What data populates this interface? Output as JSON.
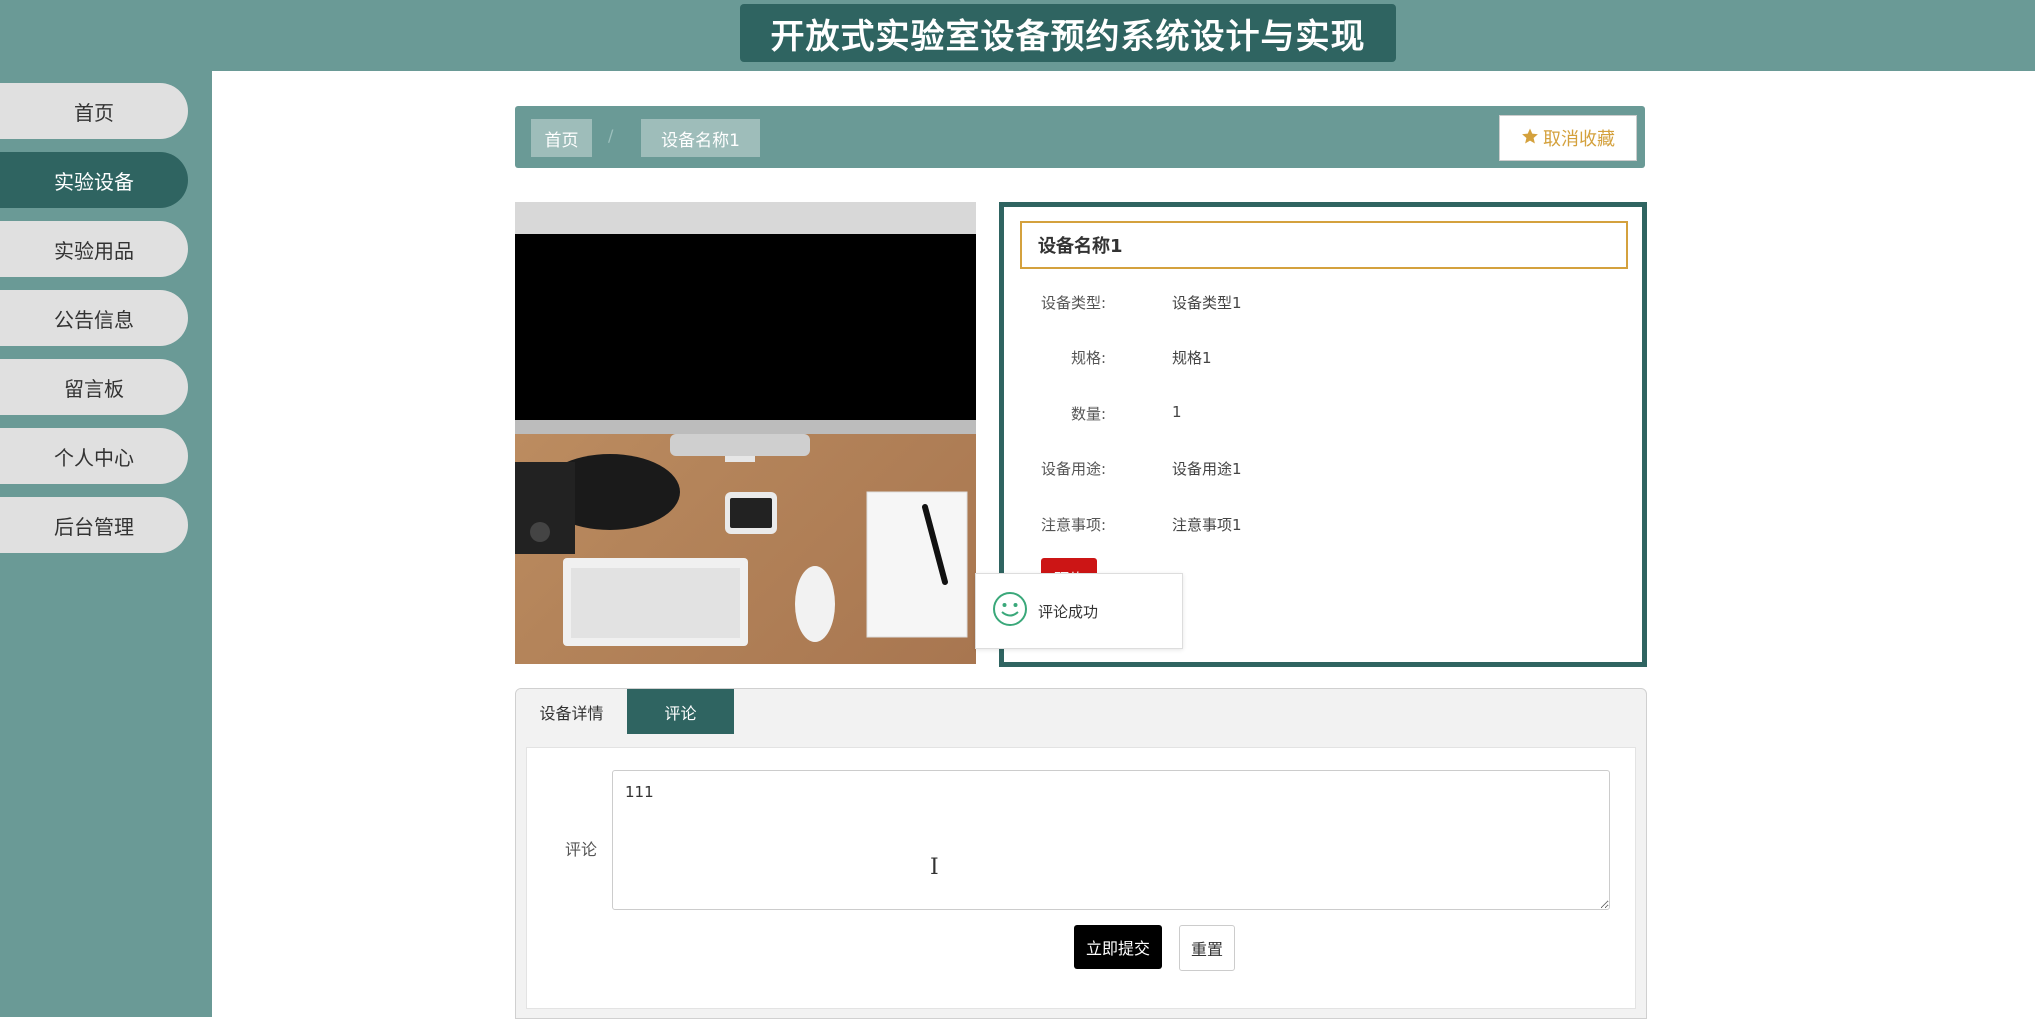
{
  "header": {
    "title": "开放式实验室设备预约系统设计与实现"
  },
  "sidebar": {
    "items": [
      {
        "label": "首页"
      },
      {
        "label": "实验设备"
      },
      {
        "label": "实验用品"
      },
      {
        "label": "公告信息"
      },
      {
        "label": "留言板"
      },
      {
        "label": "个人中心"
      },
      {
        "label": "后台管理"
      }
    ],
    "active_index": 1
  },
  "breadcrumb": {
    "home": "首页",
    "separator": "/",
    "current": "设备名称1",
    "favorite_label": "取消收藏",
    "favorite_icon": "star-icon"
  },
  "detail": {
    "name": "设备名称1",
    "fields": [
      {
        "label": "设备类型:",
        "value": "设备类型1"
      },
      {
        "label": "规格:",
        "value": "规格1"
      },
      {
        "label": "数量:",
        "value": "1"
      },
      {
        "label": "设备用途:",
        "value": "设备用途1"
      },
      {
        "label": "注意事项:",
        "value": "注意事项1"
      }
    ],
    "action_label": "预约"
  },
  "toast": {
    "message": "评论成功",
    "icon": "smiley-icon"
  },
  "tabs": [
    {
      "label": "设备详情"
    },
    {
      "label": "评论"
    }
  ],
  "comment_form": {
    "label": "评论",
    "value": "111",
    "submit_label": "立即提交",
    "reset_label": "重置"
  },
  "colors": {
    "primary": "#2f6461",
    "secondary": "#6a9a96",
    "accent": "#d4a13d",
    "danger": "#cc1515"
  }
}
